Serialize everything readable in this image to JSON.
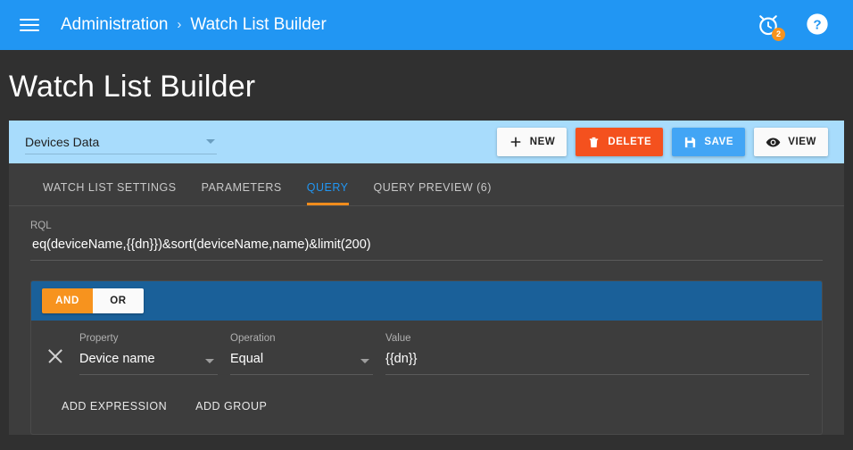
{
  "appbar": {
    "menu_icon": "hamburger-menu-icon",
    "breadcrumb": {
      "parent": "Administration",
      "separator": "›",
      "current": "Watch List Builder"
    },
    "alarm_icon": "alarm-clock-icon",
    "alarm_badge_count": "2",
    "help_icon": "help-circle-icon",
    "accent_color": "#2196F3"
  },
  "page": {
    "title": "Watch List Builder",
    "background_color": "#303030"
  },
  "toolbar": {
    "datasource_label": "Devices Data",
    "datasource_caret_icon": "chevron-down-icon",
    "header_color": "#a8dcfc",
    "buttons": [
      {
        "label": "NEW",
        "icon": "plus-icon",
        "color": "#fafafa"
      },
      {
        "label": "DELETE",
        "icon": "trash-icon",
        "color": "#F4511E"
      },
      {
        "label": "SAVE",
        "icon": "floppy-disk-icon",
        "color": "#42A5F5"
      },
      {
        "label": "VIEW",
        "icon": "eye-icon",
        "color": "#fafafa"
      }
    ]
  },
  "tabs": {
    "active_color": "#2196F3",
    "indicator_color": "#F08C1C",
    "items": [
      {
        "label": "WATCH LIST SETTINGS",
        "active": false
      },
      {
        "label": "PARAMETERS",
        "active": false
      },
      {
        "label": "QUERY",
        "active": true
      },
      {
        "label": "QUERY PREVIEW (6)",
        "active": false
      }
    ]
  },
  "query": {
    "rql_label": "RQL",
    "rql_value": "eq(deviceName,{{dn}})&sort(deviceName,name)&limit(200)",
    "rql_placeholder": "",
    "group": {
      "header_color": "#1A6099",
      "logic_and": "AND",
      "logic_or": "OR",
      "selected_logic": "AND",
      "selected_color": "#F7931E",
      "remove_icon": "close-x-icon",
      "property_label": "Property",
      "property_value": "Device name",
      "operation_label": "Operation",
      "operation_value": "Equal",
      "value_label": "Value",
      "value_value": "{{dn}}",
      "add_expression_label": "ADD EXPRESSION",
      "add_group_label": "ADD GROUP"
    }
  }
}
